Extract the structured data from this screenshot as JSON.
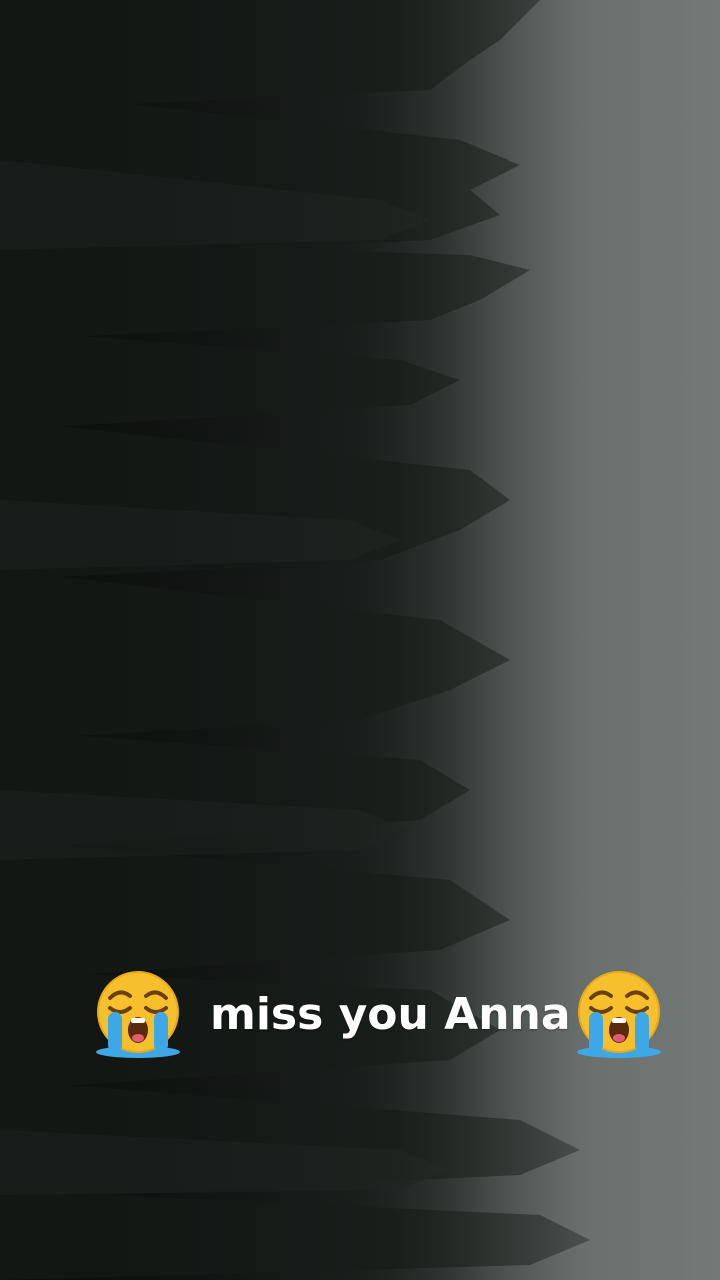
{
  "video": {
    "background_description_icon": "misty-forest-image",
    "caption": {
      "left_emoji_icon": "loudly-crying-face-icon",
      "text": "miss you Anna",
      "right_emoji_icon": "loudly-crying-face-icon"
    }
  },
  "colors": {
    "caption_text": "#ffffff",
    "fog": "#727876",
    "forest_dark": "#0e100f",
    "emoji_face": "#f5c02c",
    "emoji_tears": "#3ea8e6"
  }
}
